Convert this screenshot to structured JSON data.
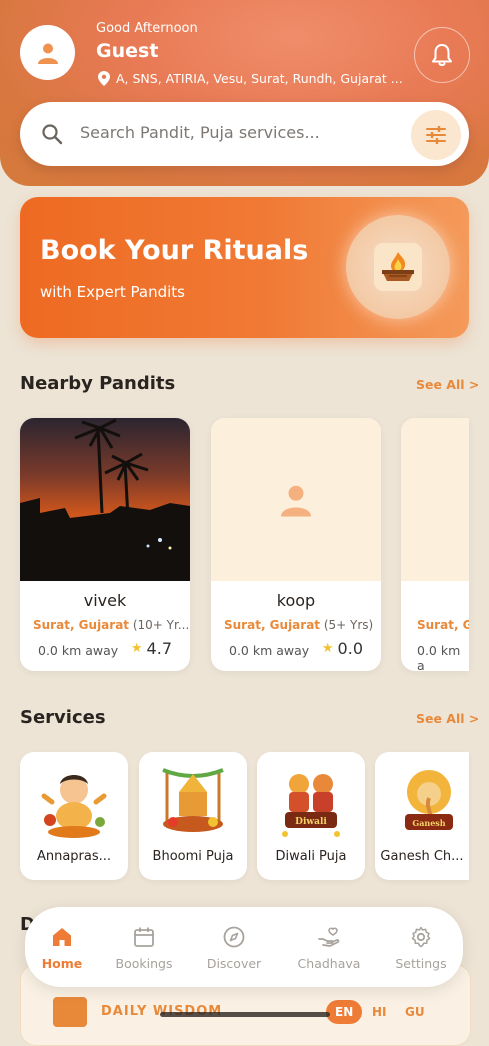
{
  "header": {
    "greeting": "Good Afternoon",
    "user_name": "Guest",
    "location": "A, SNS, ATIRIA, Vesu, Surat, Rundh, Gujarat ..."
  },
  "search": {
    "placeholder": "Search Pandit, Puja services..."
  },
  "banner": {
    "title": "Book Your Rituals",
    "subtitle": "with Expert Pandits"
  },
  "nearby": {
    "title": "Nearby Pandits",
    "see_all": "See All >",
    "pandits": [
      {
        "name": "vivek",
        "city": "Surat, Gujarat",
        "experience": "(10+ Yr...",
        "distance": "0.0 km away",
        "rating": "4.7"
      },
      {
        "name": "koop",
        "city": "Surat, Gujarat",
        "experience": "(5+ Yrs)",
        "distance": "0.0 km away",
        "rating": "0.0"
      },
      {
        "name": "",
        "city": "Surat, G",
        "experience": "",
        "distance": "0.0 km a",
        "rating": ""
      }
    ]
  },
  "services": {
    "title": "Services",
    "see_all": "See All >",
    "items": [
      {
        "label": "Annapras..."
      },
      {
        "label": "Bhoomi Puja"
      },
      {
        "label": "Diwali Puja"
      },
      {
        "label": "Ganesh Ch..."
      }
    ]
  },
  "next_section": {
    "title_partial": "D"
  },
  "wisdom": {
    "title": "DAILY WISDOM",
    "languages": [
      "EN",
      "HI",
      "GU"
    ],
    "active_language": "EN"
  },
  "nav": {
    "items": [
      {
        "label": "Home",
        "icon": "home-icon",
        "active": true
      },
      {
        "label": "Bookings",
        "icon": "calendar-icon",
        "active": false
      },
      {
        "label": "Discover",
        "icon": "compass-icon",
        "active": false
      },
      {
        "label": "Chadhava",
        "icon": "offering-hand-icon",
        "active": false
      },
      {
        "label": "Settings",
        "icon": "gear-icon",
        "active": false
      }
    ]
  },
  "colors": {
    "accent": "#ee7c36",
    "header": "#e87a55",
    "background": "#ede4d6",
    "link": "#e8893a"
  }
}
